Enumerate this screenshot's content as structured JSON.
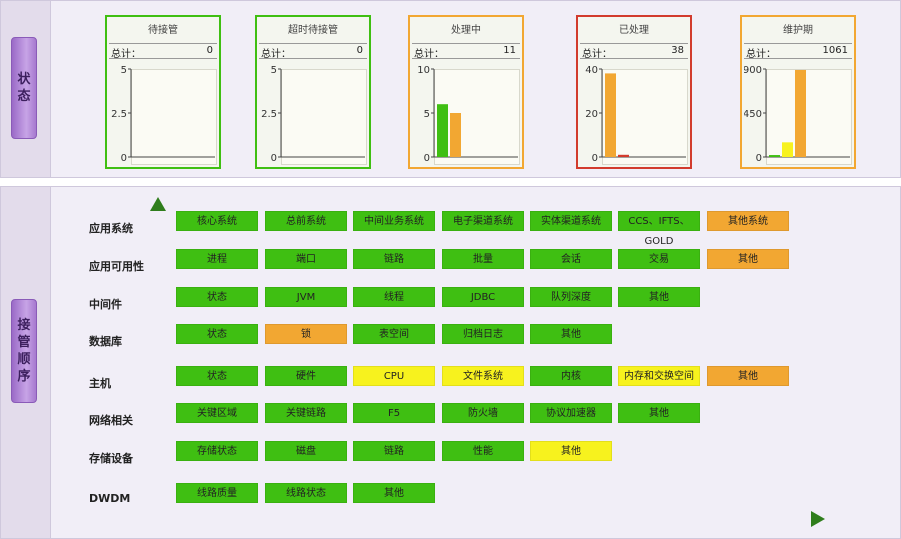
{
  "sections": {
    "status_label": [
      "状",
      "态"
    ],
    "order_label": [
      "接",
      "管",
      "顺",
      "序"
    ]
  },
  "colors": {
    "green": "#3fbf12",
    "yellow": "#f7f21e",
    "orange": "#f2a732",
    "red": "#d23b2d"
  },
  "total_label": "总计：",
  "status_cards": [
    {
      "title": "待接管",
      "total": "0",
      "border": "green",
      "y_ticks": [
        "5",
        "2.5",
        "0"
      ]
    },
    {
      "title": "超时待接管",
      "total": "0",
      "border": "green",
      "y_ticks": [
        "5",
        "2.5",
        "0"
      ]
    },
    {
      "title": "处理中",
      "total": "11",
      "border": "orange",
      "y_ticks": [
        "10",
        "5",
        "0"
      ]
    },
    {
      "title": "已处理",
      "total": "38",
      "border": "red",
      "y_ticks": [
        "40",
        "20",
        "0"
      ]
    },
    {
      "title": "维护期",
      "total": "1061",
      "border": "orange",
      "y_ticks": [
        "900",
        "450",
        "0"
      ]
    }
  ],
  "chart_data": [
    {
      "type": "bar",
      "title": "待接管",
      "ylim": [
        0,
        5
      ],
      "series": []
    },
    {
      "type": "bar",
      "title": "超时待接管",
      "ylim": [
        0,
        5
      ],
      "series": []
    },
    {
      "type": "bar",
      "title": "处理中",
      "ylim": [
        0,
        10
      ],
      "series": [
        {
          "color": "green",
          "value": 6
        },
        {
          "color": "orange",
          "value": 5
        }
      ]
    },
    {
      "type": "bar",
      "title": "已处理",
      "ylim": [
        0,
        40
      ],
      "series": [
        {
          "color": "orange",
          "value": 38
        },
        {
          "color": "red",
          "value": 1
        }
      ]
    },
    {
      "type": "bar",
      "title": "维护期",
      "ylim": [
        0,
        900
      ],
      "series": [
        {
          "color": "green",
          "value": 20
        },
        {
          "color": "yellow",
          "value": 150
        },
        {
          "color": "orange",
          "value": 890
        }
      ]
    }
  ],
  "rows": [
    {
      "label": "应用系统",
      "cells": [
        {
          "text": "核心系统",
          "color": "green"
        },
        {
          "text": "总前系统",
          "color": "green"
        },
        {
          "text": "中间业务系统",
          "color": "green"
        },
        {
          "text": "电子渠道系统",
          "color": "green"
        },
        {
          "text": "实体渠道系统",
          "color": "green"
        },
        {
          "text": "CCS、IFTS、GOLD",
          "color": "green"
        },
        {
          "text": "其他系统",
          "color": "orange"
        }
      ]
    },
    {
      "label": "应用可用性",
      "cells": [
        {
          "text": "进程",
          "color": "green"
        },
        {
          "text": "端口",
          "color": "green"
        },
        {
          "text": "链路",
          "color": "green"
        },
        {
          "text": "批量",
          "color": "green"
        },
        {
          "text": "会话",
          "color": "green"
        },
        {
          "text": "交易",
          "color": "green"
        },
        {
          "text": "其他",
          "color": "orange"
        }
      ]
    },
    {
      "label": "中间件",
      "cells": [
        {
          "text": "状态",
          "color": "green"
        },
        {
          "text": "JVM",
          "color": "green"
        },
        {
          "text": "线程",
          "color": "green"
        },
        {
          "text": "JDBC",
          "color": "green"
        },
        {
          "text": "队列深度",
          "color": "green"
        },
        {
          "text": "其他",
          "color": "green"
        }
      ]
    },
    {
      "label": "数据库",
      "cells": [
        {
          "text": "状态",
          "color": "green"
        },
        {
          "text": "锁",
          "color": "orange"
        },
        {
          "text": "表空间",
          "color": "green"
        },
        {
          "text": "归档日志",
          "color": "green"
        },
        {
          "text": "其他",
          "color": "green"
        }
      ]
    },
    {
      "label": "主机",
      "cells": [
        {
          "text": "状态",
          "color": "green"
        },
        {
          "text": "硬件",
          "color": "green"
        },
        {
          "text": "CPU",
          "color": "yellow"
        },
        {
          "text": "文件系统",
          "color": "yellow"
        },
        {
          "text": "内核",
          "color": "green"
        },
        {
          "text": "内存和交换空间",
          "color": "yellow"
        },
        {
          "text": "其他",
          "color": "orange"
        }
      ]
    },
    {
      "label": "网络相关",
      "cells": [
        {
          "text": "关键区域",
          "color": "green"
        },
        {
          "text": "关键链路",
          "color": "green"
        },
        {
          "text": "F5",
          "color": "green"
        },
        {
          "text": "防火墙",
          "color": "green"
        },
        {
          "text": "协议加速器",
          "color": "green"
        },
        {
          "text": "其他",
          "color": "green"
        }
      ]
    },
    {
      "label": "存储设备",
      "cells": [
        {
          "text": "存储状态",
          "color": "green"
        },
        {
          "text": "磁盘",
          "color": "green"
        },
        {
          "text": "链路",
          "color": "green"
        },
        {
          "text": "性能",
          "color": "green"
        },
        {
          "text": "其他",
          "color": "yellow"
        }
      ]
    },
    {
      "label": "DWDM",
      "cells": [
        {
          "text": "线路质量",
          "color": "green"
        },
        {
          "text": "线路状态",
          "color": "green"
        },
        {
          "text": "其他",
          "color": "green"
        }
      ]
    }
  ]
}
